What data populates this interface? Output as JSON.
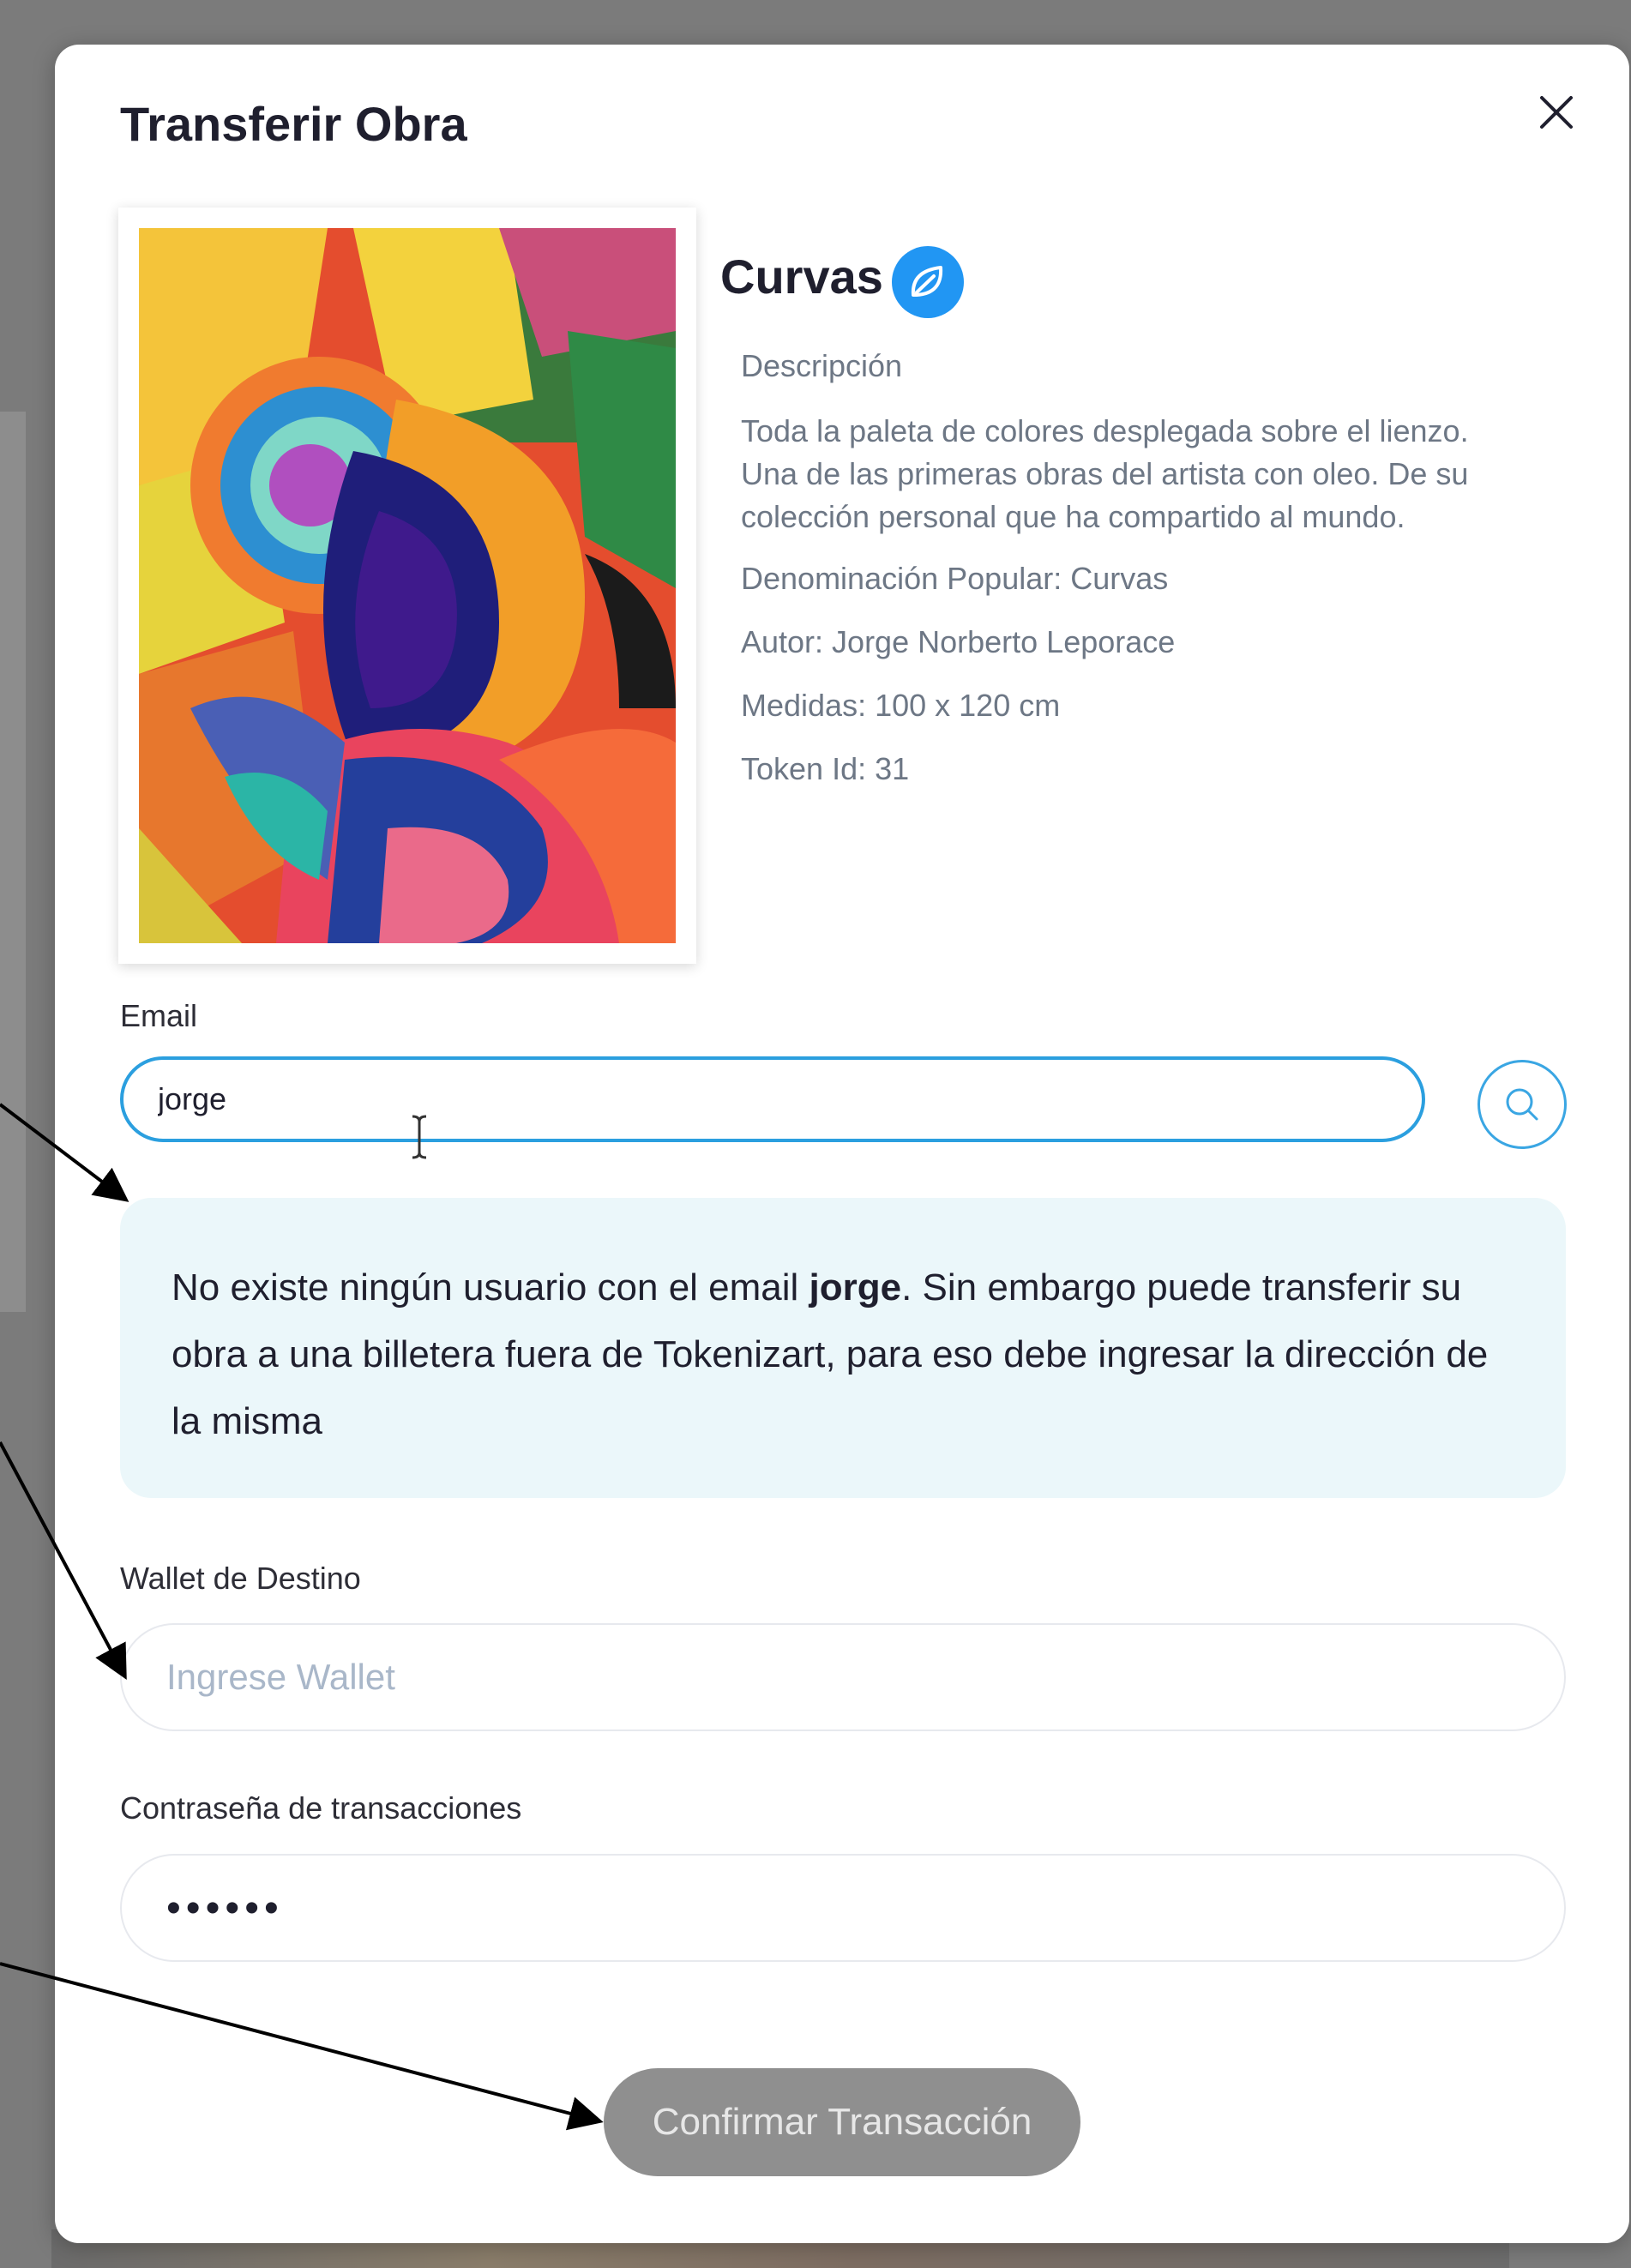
{
  "modal": {
    "title": "Transferir Obra",
    "close_icon": "close-icon"
  },
  "artwork": {
    "name": "Curvas",
    "badge_icon": "leaf-icon",
    "badge_color": "#2196f3",
    "description_label": "Descripción",
    "description_lines": [
      "Toda la paleta de colores desplegada sobre el lienzo.",
      "Una de las primeras obras del artista con oleo. De su",
      "colección personal que ha compartido al mundo."
    ],
    "popular_name": "Denominación Popular: Curvas",
    "author": "Autor: Jorge Norberto Leporace",
    "measures": "Medidas: 100 x 120 cm",
    "token_id": "Token Id: 31"
  },
  "email_field": {
    "label": "Email",
    "value": "jorge",
    "search_icon": "search-icon"
  },
  "alert": {
    "text_before": "No existe ningún usuario con el email ",
    "email_bold": "jorge",
    "text_after": ". Sin embargo puede transferir su obra a una billetera fuera de Tokenizart, para eso debe ingresar la dirección de la misma"
  },
  "wallet_field": {
    "label": "Wallet de Destino",
    "placeholder": "Ingrese Wallet",
    "value": ""
  },
  "password_field": {
    "label": "Contraseña de transacciones",
    "value": "••••••"
  },
  "confirm_button": {
    "label": "Confirmar Transacción"
  },
  "colors": {
    "accent": "#2b9fdf",
    "alert_background": "#ebf7fa",
    "button_disabled": "#8f8f8f"
  }
}
